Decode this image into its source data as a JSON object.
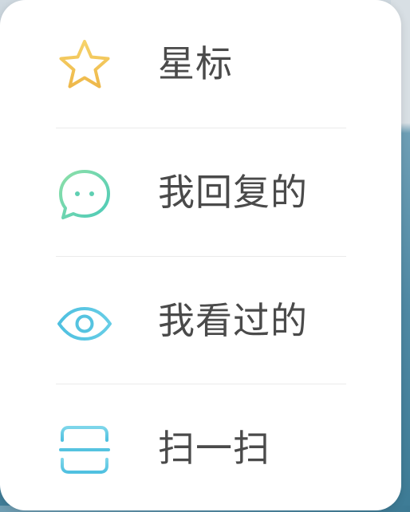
{
  "menu": {
    "items": [
      {
        "label": "星标",
        "icon": "star-icon",
        "color": "#f0c24c"
      },
      {
        "label": "我回复的",
        "icon": "chat-bubble-icon",
        "color": "#5fd3b0"
      },
      {
        "label": "我看过的",
        "icon": "eye-icon",
        "color": "#55c3e0"
      },
      {
        "label": "扫一扫",
        "icon": "scan-icon",
        "color": "#55c3e0"
      }
    ]
  }
}
